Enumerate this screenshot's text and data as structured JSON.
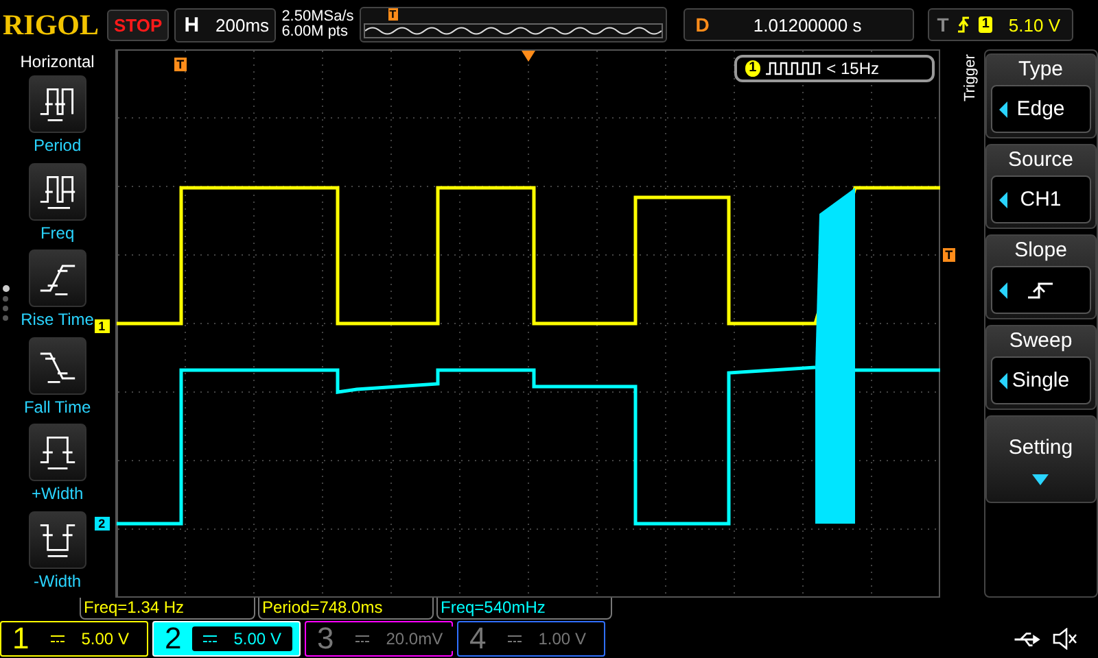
{
  "brand": "RIGOL",
  "run_state": "STOP",
  "horizontal": {
    "label": "H",
    "timebase": "200ms"
  },
  "sample_rate": "2.50MSa/s",
  "memory_depth": "6.00M pts",
  "delay": {
    "label": "D",
    "value": "1.01200000 s"
  },
  "trigger_status": {
    "label": "T",
    "source": "1",
    "level": "5.10 V"
  },
  "left_menu": {
    "title": "Horizontal",
    "items": [
      {
        "label": "Period",
        "kind": "period"
      },
      {
        "label": "Freq",
        "kind": "freq"
      },
      {
        "label": "Rise Time",
        "kind": "rise"
      },
      {
        "label": "Fall Time",
        "kind": "fall"
      },
      {
        "label": "+Width",
        "kind": "pwidth"
      },
      {
        "label": "-Width",
        "kind": "nwidth"
      }
    ]
  },
  "page_dots": [
    {
      "selected": true
    },
    {
      "selected": false
    },
    {
      "selected": false
    },
    {
      "selected": false
    }
  ],
  "trigger_menu": {
    "title": "Trigger",
    "items": [
      {
        "label": "Type",
        "kind": "value",
        "value": "Edge"
      },
      {
        "label": "Source",
        "kind": "value",
        "value": "CH1"
      },
      {
        "label": "Slope",
        "kind": "slope"
      },
      {
        "label": "Sweep",
        "kind": "value",
        "value": "Single"
      },
      {
        "label": "Setting",
        "kind": "submenu"
      }
    ]
  },
  "freq_counter": {
    "channel": "1",
    "text": "< 15Hz"
  },
  "markers": {
    "ch1": "1",
    "ch2": "2",
    "trigger_time": "T",
    "trigger_level": "T",
    "overview_trigger": "T"
  },
  "measurements": [
    {
      "text": "Freq=1.34 Hz",
      "color": "#ffff00"
    },
    {
      "text": "Period=748.0ms",
      "color": "#ffff00"
    },
    {
      "text": "Freq=540mHz",
      "color": "#00ffff"
    }
  ],
  "channels": [
    {
      "number": "1",
      "scale": "5.00 V",
      "on": true,
      "selected": false,
      "color": "#ffff00"
    },
    {
      "number": "2",
      "scale": "5.00 V",
      "on": true,
      "selected": true,
      "color": "#00ffff"
    },
    {
      "number": "3",
      "scale": "20.0mV",
      "on": false,
      "selected": false,
      "color": "#ff00ff"
    },
    {
      "number": "4",
      "scale": "1.00 V",
      "on": false,
      "selected": false,
      "color": "#3070ff"
    }
  ]
}
